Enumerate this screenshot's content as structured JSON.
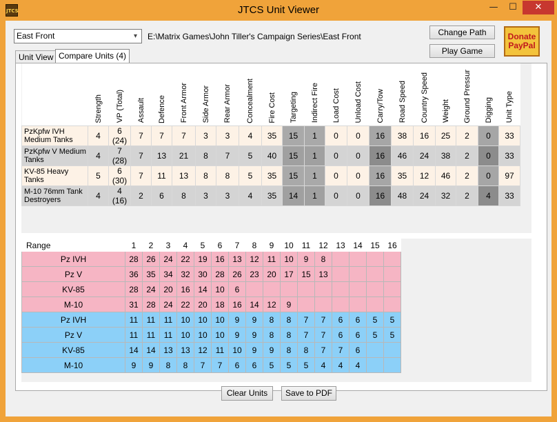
{
  "window": {
    "title": "JTCS Unit Viewer",
    "icon_text": "JTCS",
    "min_glyph": "—",
    "max_glyph": "☐",
    "close_glyph": "✕"
  },
  "toolbar": {
    "front_selected": "East Front",
    "dropdown_glyph": "▾",
    "path": "E:\\Matrix Games\\John Tiller's Campaign Series\\East Front",
    "change_path_label": "Change Path",
    "play_game_label": "Play Game",
    "donate_line1": "Donate",
    "donate_line2": "PayPal"
  },
  "tabs": [
    {
      "label": "Unit View"
    },
    {
      "label": "Compare Units (4)"
    }
  ],
  "compare": {
    "columns": [
      "Strength",
      "VP (Total)",
      "Assault",
      "Defence",
      "Front Armor",
      "Side Armor",
      "Rear Armor",
      "Concealment",
      "Fire Cost",
      "Targeting",
      "Indirect Fire",
      "Load Cost",
      "Unload Cost",
      "Carry/Tow",
      "Road Speed",
      "Country Speed",
      "Weight",
      "Ground Pressur",
      "Digging",
      "Unit Type"
    ],
    "units": [
      {
        "name": "PzKpfw IVH Medium Tanks",
        "values": [
          "4",
          "6 (24)",
          "7",
          "7",
          "7",
          "3",
          "3",
          "4",
          "35",
          "15",
          "1",
          "0",
          "0",
          "16",
          "38",
          "16",
          "25",
          "2",
          "0",
          "33"
        ]
      },
      {
        "name": "PzKpfw V Medium Tanks",
        "values": [
          "4",
          "7 (28)",
          "7",
          "13",
          "21",
          "8",
          "7",
          "5",
          "40",
          "15",
          "1",
          "0",
          "0",
          "16",
          "46",
          "24",
          "38",
          "2",
          "0",
          "33"
        ]
      },
      {
        "name": "KV-85 Heavy Tanks",
        "values": [
          "5",
          "6 (30)",
          "7",
          "11",
          "13",
          "8",
          "8",
          "5",
          "35",
          "15",
          "1",
          "0",
          "0",
          "16",
          "35",
          "12",
          "46",
          "2",
          "0",
          "97"
        ]
      },
      {
        "name": "M-10 76mm Tank Destroyers",
        "values": [
          "4",
          "4 (16)",
          "2",
          "6",
          "8",
          "3",
          "3",
          "4",
          "35",
          "14",
          "1",
          "0",
          "0",
          "16",
          "48",
          "24",
          "32",
          "2",
          "4",
          "33"
        ]
      }
    ]
  },
  "range": {
    "header": "Range",
    "ranges": [
      "1",
      "2",
      "3",
      "4",
      "5",
      "6",
      "7",
      "8",
      "9",
      "10",
      "11",
      "12",
      "13",
      "14",
      "15",
      "16"
    ],
    "pink_rows": [
      {
        "name": "Pz IVH",
        "values": [
          "28",
          "26",
          "24",
          "22",
          "19",
          "16",
          "13",
          "12",
          "11",
          "10",
          "9",
          "8",
          "",
          "",
          "",
          ""
        ]
      },
      {
        "name": "Pz V",
        "values": [
          "36",
          "35",
          "34",
          "32",
          "30",
          "28",
          "26",
          "23",
          "20",
          "17",
          "15",
          "13",
          "",
          "",
          "",
          ""
        ]
      },
      {
        "name": "KV-85",
        "values": [
          "28",
          "24",
          "20",
          "16",
          "14",
          "10",
          "6",
          "",
          "",
          "",
          "",
          "",
          "",
          "",
          "",
          ""
        ]
      },
      {
        "name": "M-10",
        "values": [
          "31",
          "28",
          "24",
          "22",
          "20",
          "18",
          "16",
          "14",
          "12",
          "9",
          "",
          "",
          "",
          "",
          "",
          ""
        ]
      }
    ],
    "blue_rows": [
      {
        "name": "Pz IVH",
        "values": [
          "11",
          "11",
          "11",
          "10",
          "10",
          "10",
          "9",
          "9",
          "8",
          "8",
          "7",
          "7",
          "6",
          "6",
          "5",
          "5"
        ]
      },
      {
        "name": "Pz V",
        "values": [
          "11",
          "11",
          "11",
          "10",
          "10",
          "10",
          "9",
          "9",
          "8",
          "8",
          "7",
          "7",
          "6",
          "6",
          "5",
          "5"
        ]
      },
      {
        "name": "KV-85",
        "values": [
          "14",
          "14",
          "13",
          "13",
          "12",
          "11",
          "10",
          "9",
          "9",
          "8",
          "8",
          "7",
          "7",
          "6",
          "",
          ""
        ]
      },
      {
        "name": "M-10",
        "values": [
          "9",
          "9",
          "8",
          "8",
          "7",
          "7",
          "6",
          "6",
          "5",
          "5",
          "5",
          "4",
          "4",
          "4",
          "",
          ""
        ]
      }
    ]
  },
  "footer": {
    "clear_units_label": "Clear Units",
    "save_pdf_label": "Save to PDF"
  },
  "colors": {
    "window_frame": "#f0a33a",
    "close_button": "#c7372f",
    "pink_rows": "#f6b5c4",
    "blue_rows": "#8cd0f8",
    "donate_text": "#c0161c"
  }
}
